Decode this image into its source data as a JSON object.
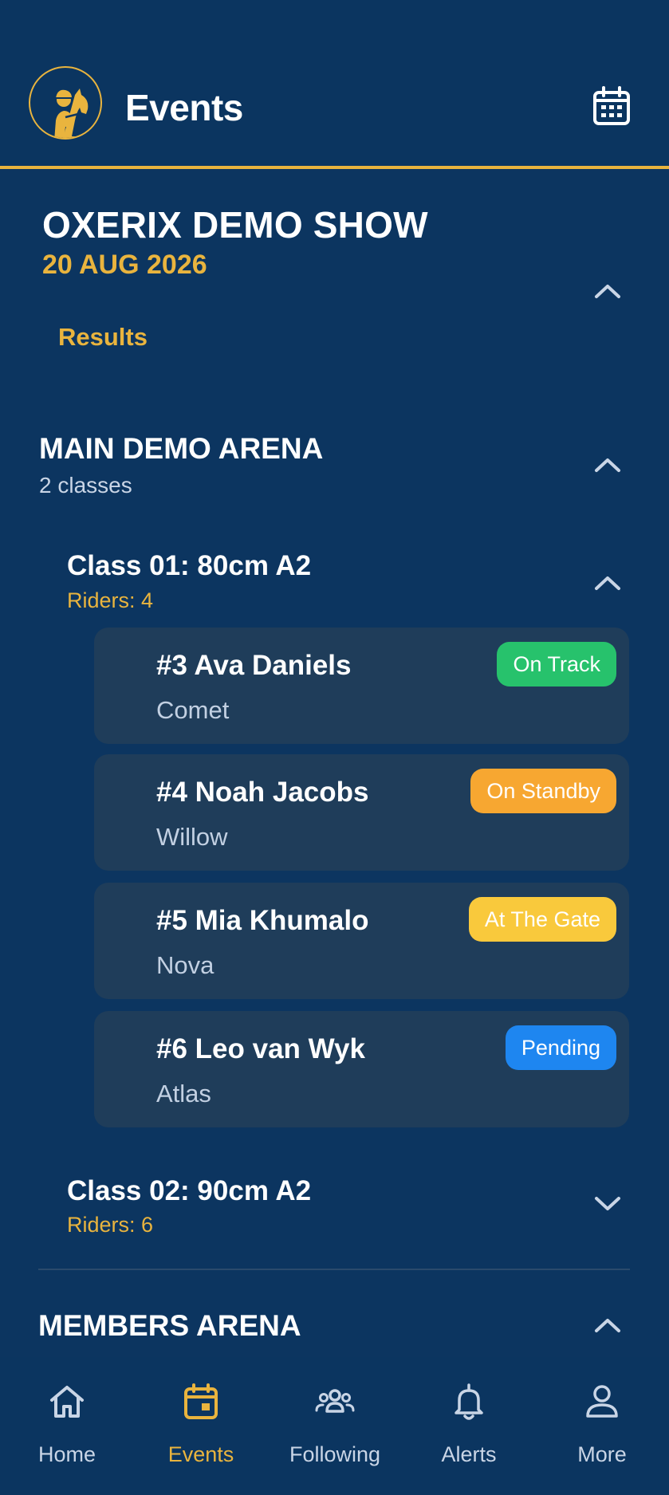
{
  "header": {
    "title": "Events",
    "logo_icon": "horse-rider-logo",
    "calendar_icon": "calendar-icon"
  },
  "event": {
    "name": "OXERIX DEMO SHOW",
    "date": "20 AUG 2026",
    "results_label": "Results",
    "expanded": true
  },
  "arena": {
    "name": "MAIN DEMO ARENA",
    "subtitle": "2 classes",
    "expanded": true
  },
  "class1": {
    "title": "Class 01: 80cm A2",
    "riders": "Riders: 4",
    "expanded": true
  },
  "riders": [
    {
      "name": "#3 Ava Daniels",
      "horse": "Comet",
      "status": "On Track",
      "status_color": "#27c26c",
      "text_color": "#ffffff"
    },
    {
      "name": "#4 Noah Jacobs",
      "horse": "Willow",
      "status": "On Standby",
      "status_color": "#f7a731",
      "text_color": "#ffffff"
    },
    {
      "name": "#5 Mia Khumalo",
      "horse": "Nova",
      "status": "At The Gate",
      "status_color": "#f9c93c",
      "text_color": "#ffffff"
    },
    {
      "name": "#6 Leo van Wyk",
      "horse": "Atlas",
      "status": "Pending",
      "status_color": "#1e86f0",
      "text_color": "#ffffff"
    }
  ],
  "class2": {
    "title": "Class 02: 90cm A2",
    "riders": "Riders: 6",
    "expanded": false
  },
  "arena2": {
    "name": "MEMBERS ARENA",
    "expanded": true
  },
  "nav": {
    "items": [
      {
        "label": "Home",
        "icon": "home-icon",
        "active": false
      },
      {
        "label": "Events",
        "icon": "calendar-icon",
        "active": true
      },
      {
        "label": "Following",
        "icon": "people-icon",
        "active": false
      },
      {
        "label": "Alerts",
        "icon": "bell-icon",
        "active": false
      },
      {
        "label": "More",
        "icon": "user-icon",
        "active": false
      }
    ]
  },
  "colors": {
    "background": "#0c3560",
    "accent": "#e9b43e",
    "card": "#1f3d5a"
  }
}
